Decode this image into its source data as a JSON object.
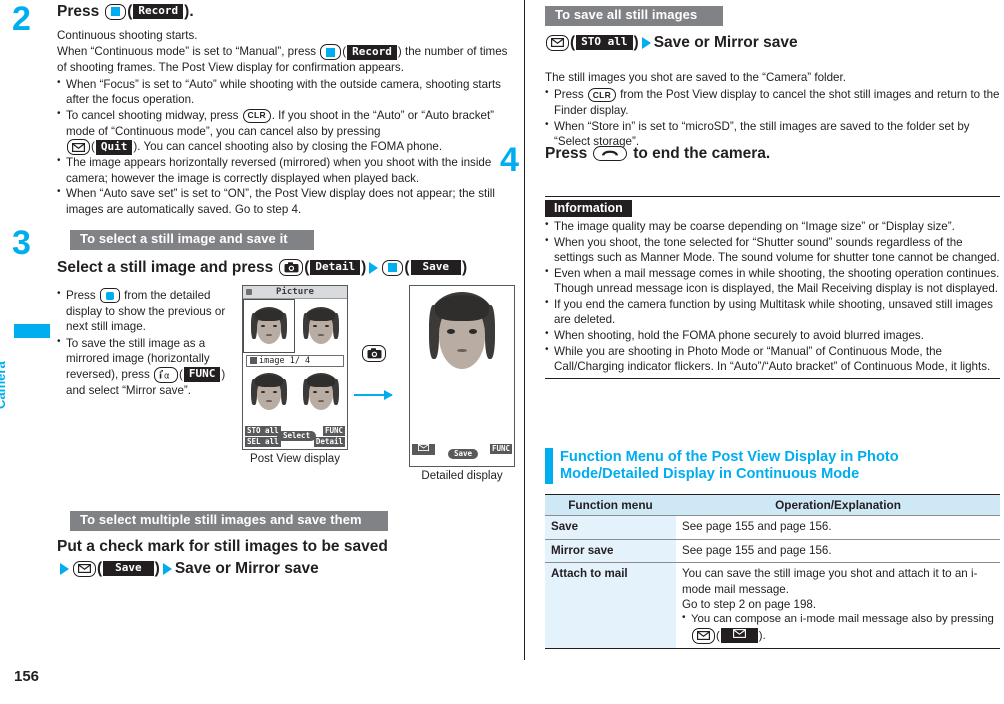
{
  "sidebar": {
    "tab_label": "Camera",
    "page_number": "156"
  },
  "left_column": {
    "step2": {
      "number": "2",
      "heading_prefix": "Press",
      "heading_key": "ok-key",
      "heading_softkey": "Record",
      "heading_suffix": ").",
      "lead1": "Continuous shooting starts.",
      "lead2_a": "When “Continuous mode” is set to “Manual”, press",
      "lead2_softkey": "Record",
      "lead2_b": ") the number of times of shooting frames. The Post View display for confirmation appears.",
      "bullets": [
        "When “Focus” is set to “Auto” while shooting with the outside camera, shooting starts after the focus operation.",
        "To cancel shooting midway, press CLR. If you shoot in the “Auto” or “Auto bracket” mode of “Continuous mode”, you can cancel also by pressing (Quit). You can cancel shooting also by closing the FOMA phone.",
        "The image appears horizontally reversed (mirrored) when you shoot with the inside camera; however the image is correctly displayed when played back.",
        "When “Auto save set” is set to “ON”, the Post View display does not appear; the still images are automatically saved. Go to step 4."
      ],
      "bullet2_parts": {
        "a": "To cancel shooting midway, press",
        "clr": "CLR",
        "b": ". If you shoot in the “Auto” or “Auto bracket” mode of “Continuous mode”, you can cancel also by pressing",
        "quit": "Quit",
        "c": "). You can cancel shooting also by closing the FOMA phone."
      }
    },
    "step3": {
      "number": "3",
      "grey_bar": "To select a still image and save it",
      "heading_a": "Select a still image and press",
      "heading_sk1": "Detail",
      "heading_sk2": "Save",
      "bullets_parts": [
        {
          "a": "Press",
          "key": "multi-cursor-key",
          "b": "from the detailed display to show the previous or next still image."
        },
        {
          "a": "To save the still image as a mirrored image (horizontally reversed), press",
          "key": "imode-key",
          "sk": "FUNC",
          "b": ") and select “Mirror save”."
        }
      ]
    },
    "mockups": {
      "postview": {
        "title": "Picture",
        "caption_bar": "image  1/ 4",
        "softkeys": [
          "STO all",
          "SEL all",
          "Select",
          "FUNC",
          "Detail"
        ],
        "label": "Post View display"
      },
      "detailed": {
        "softkeys": [
          "mail-icon",
          "Save",
          "FUNC"
        ],
        "label": "Detailed display"
      },
      "mid_key": "camera-key"
    },
    "multi_section": {
      "grey_bar": "To select multiple still images and save them",
      "heading": "Put a check mark for still images to be saved",
      "line2_sk": "Save",
      "line2_tail": "Save or Mirror save"
    }
  },
  "right_column": {
    "save_all": {
      "grey_bar": "To save all still images",
      "heading_sk": "STO all",
      "heading_tail": "Save or Mirror save",
      "lead": "The still images you shot are saved to the “Camera” folder.",
      "bullets_parts": [
        {
          "a": "Press",
          "clr": "CLR",
          "b": "from the Post View display to cancel the shot still images and return to the Finder display."
        },
        {
          "a": "When “Store in” is set to “microSD”, the still images are saved to the folder set by “Select storage”."
        }
      ]
    },
    "step4": {
      "number": "4",
      "heading_a": "Press",
      "heading_key": "end-key",
      "heading_b": "to end the camera."
    },
    "information": {
      "tag": "Information",
      "bullets": [
        "The image quality may be coarse depending on “Image size” or “Display size”.",
        "When you shoot, the tone selected for “Shutter sound” sounds regardless of the settings such as Manner Mode. The sound volume for shutter tone cannot be changed.",
        "Even when a mail message comes in while shooting, the shooting operation continues. Though unread message icon is displayed, the Mail Receiving display is not displayed.",
        "If you end the camera function by using Multitask while shooting, unsaved still images are deleted.",
        "When shooting, hold the FOMA phone securely to avoid blurred images.",
        "While you are shooting in Photo Mode or “Manual” of Continuous Mode, the Call/Charging indicator flickers. In “Auto”/“Auto bracket” of Continuous Mode, it lights."
      ]
    },
    "function_menu_section": {
      "title": "Function Menu of the Post View Display in Photo Mode/Detailed Display in Continuous Mode",
      "table": {
        "headers": [
          "Function menu",
          "Operation/Explanation"
        ],
        "rows": [
          {
            "name": "Save",
            "text": "See page 155 and page 156."
          },
          {
            "name": "Mirror save",
            "text": "See page 155 and page 156."
          },
          {
            "name": "Attach to mail",
            "text": "You can save the still image you shot and attach it to an i-mode mail message.",
            "text2": "Go to step 2 on page 198.",
            "bullet_a": "You can compose an i-mode mail message also by pressing",
            "bullet_sk": "mail-icon",
            "bullet_b": ")."
          }
        ]
      }
    }
  },
  "colors": {
    "accent": "#00adef",
    "grey_bar": "#808285",
    "table_header": "#cfe8f6",
    "table_cell": "#e4f2fb",
    "text": "#231f20"
  }
}
